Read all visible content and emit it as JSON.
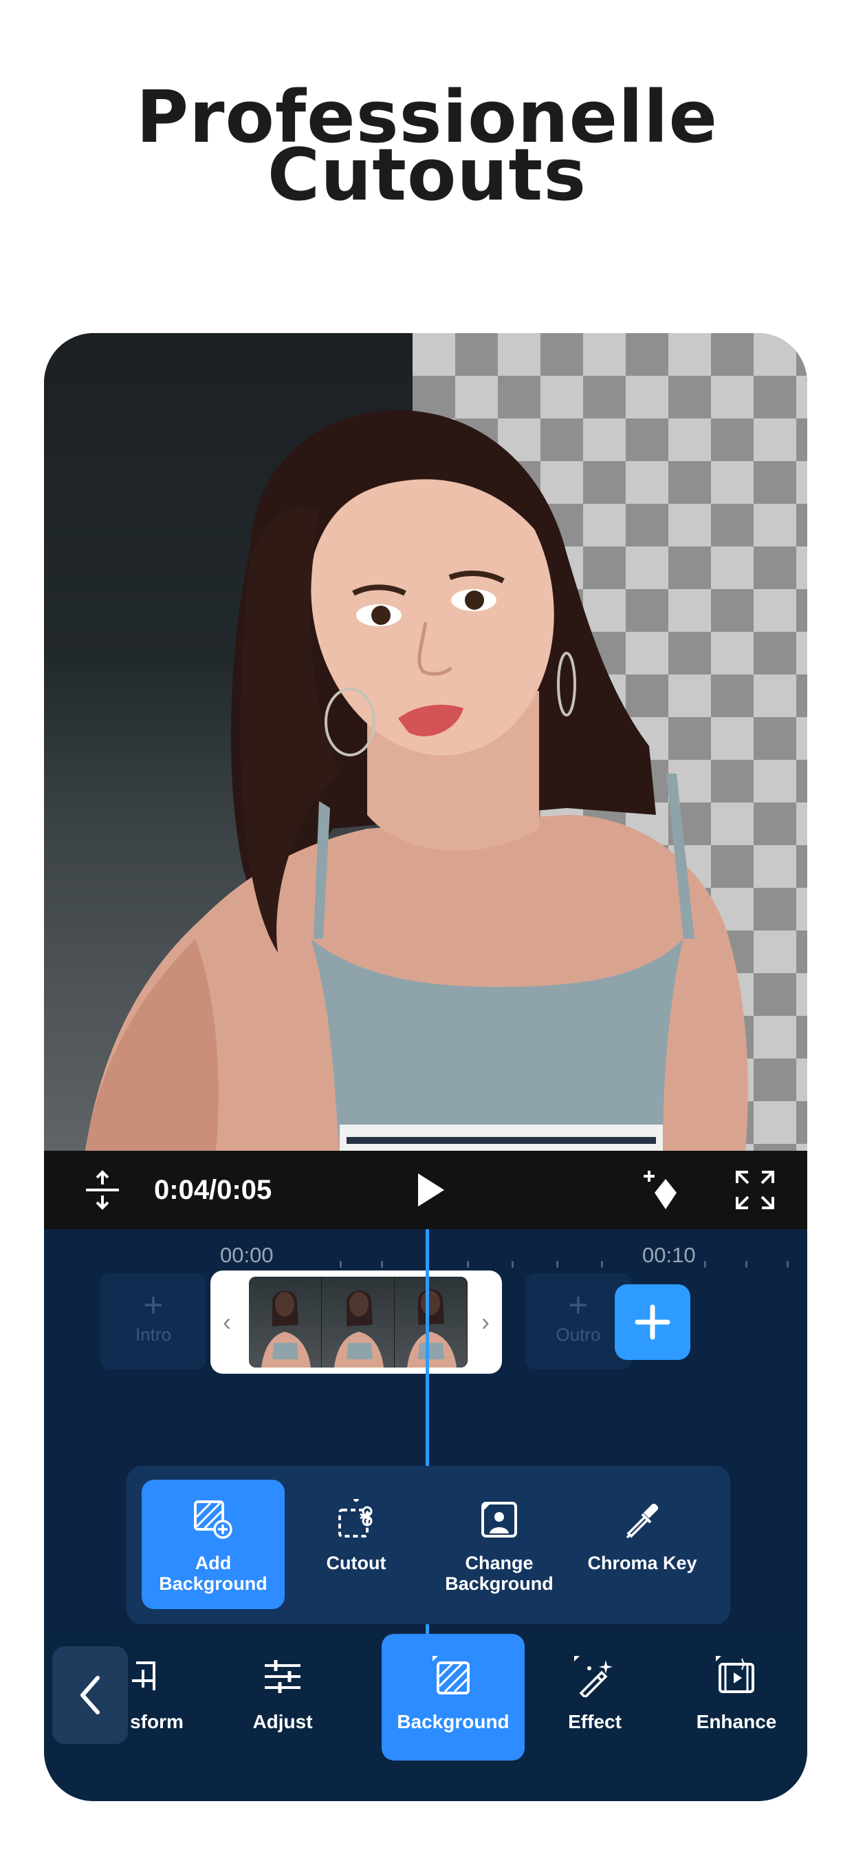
{
  "headline": {
    "line1": "Professionelle",
    "line2": "Cutouts"
  },
  "player": {
    "timecode": "0:04/0:05",
    "icons": [
      "split-height-icon",
      "play-icon",
      "keyframe-add-icon",
      "fullscreen-icon"
    ]
  },
  "timeline": {
    "ruler": [
      "00:00",
      "00:10"
    ],
    "intro_label": "Intro",
    "outro_label": "Outro",
    "intro_plus": "+",
    "outro_plus": "+",
    "clip_left": "‹",
    "clip_right": "›"
  },
  "submenu": {
    "items": [
      {
        "label": "Add Background",
        "icon": "add-background-icon",
        "active": true
      },
      {
        "label": "Cutout",
        "icon": "cutout-icon",
        "active": false
      },
      {
        "label": "Change Background",
        "icon": "change-background-icon",
        "active": false
      },
      {
        "label": "Chroma Key",
        "icon": "eyedropper-icon",
        "active": false
      }
    ]
  },
  "toolbar": {
    "items": [
      {
        "label": "sform",
        "icon": "transform-icon",
        "active": false
      },
      {
        "label": "Adjust",
        "icon": "sliders-icon",
        "active": false
      },
      {
        "label": "Background",
        "icon": "background-icon",
        "active": true
      },
      {
        "label": "Effect",
        "icon": "magic-wand-icon",
        "active": false
      },
      {
        "label": "Enhance",
        "icon": "enhance-icon",
        "active": false
      }
    ]
  },
  "colors": {
    "accent": "#2d8cff",
    "panel": "#0c2443",
    "headline": "#1c1c1c"
  }
}
